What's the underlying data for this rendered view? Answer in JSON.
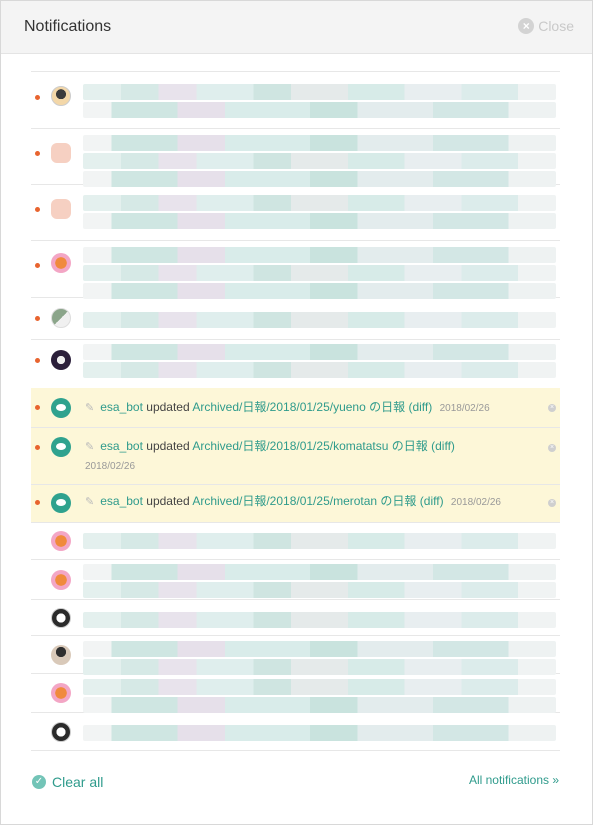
{
  "header": {
    "title": "Notifications",
    "close_label": "Close",
    "close_icon": "×"
  },
  "notifications_bot": [
    {
      "user": "esa_bot",
      "action": "updated",
      "target": "Archived/日報/2018/01/25/yueno の日報",
      "diff_open": "(",
      "diff_label": "diff",
      "diff_close": ")",
      "date": "2018/02/26"
    },
    {
      "user": "esa_bot",
      "action": "updated",
      "target": "Archived/日報/2018/01/25/komatatsu の日報",
      "diff_open": "(",
      "diff_label": "diff",
      "diff_close": ")",
      "date": "2018/02/26"
    },
    {
      "user": "esa_bot",
      "action": "updated",
      "target": "Archived/日報/2018/01/25/merotan の日報",
      "diff_open": "(",
      "diff_label": "diff",
      "diff_close": ")",
      "date": "2018/02/26"
    }
  ],
  "footer": {
    "clear_all": "Clear all",
    "all_notifications": "All notifications »"
  },
  "colors": {
    "accent": "#2f9b8c",
    "unread_dot": "#e8642f",
    "highlight": "#fdf7d8"
  }
}
